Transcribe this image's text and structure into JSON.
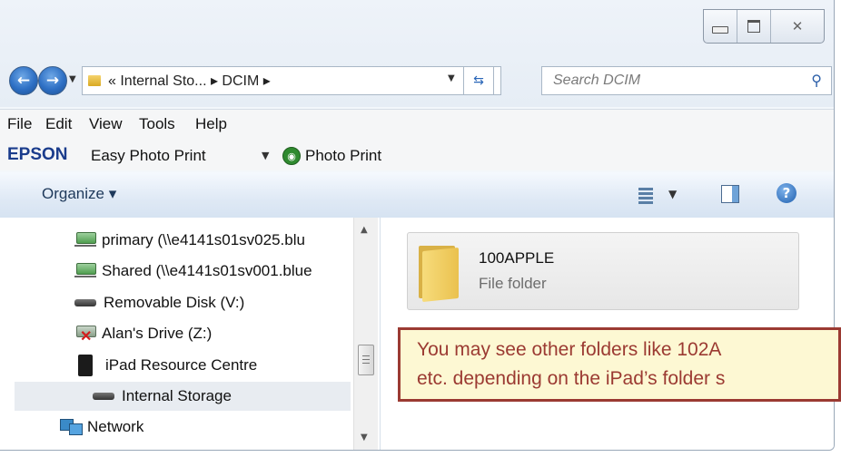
{
  "window": {
    "controls": {
      "minimize": "minimize",
      "maximize": "maximize",
      "close": "close"
    }
  },
  "navigation": {
    "address_path": "« Internal Sto... ▸ DCIM ▸",
    "search_placeholder": "Search DCIM"
  },
  "menu": {
    "items": [
      "File",
      "Edit",
      "View",
      "Tools",
      "Help"
    ]
  },
  "epson_toolbar": {
    "logo": "EPSON",
    "easy_photo_print": "Easy Photo Print",
    "photo_print": "Photo Print"
  },
  "command_bar": {
    "organize": "Organize ▾"
  },
  "nav_tree": {
    "items": [
      {
        "label": "primary (\\\\e4141s01sv025.blu",
        "icon": "network-drive-icon"
      },
      {
        "label": "Shared (\\\\e4141s01sv001.blue",
        "icon": "network-drive-icon"
      },
      {
        "label": "Removable Disk (V:)",
        "icon": "removable-disk-icon"
      },
      {
        "label": "Alan's Drive (Z:)",
        "icon": "disconnected-drive-icon"
      },
      {
        "label": "iPad Resource Centre",
        "icon": "ipad-icon"
      },
      {
        "label": "Internal Storage",
        "icon": "disk-icon",
        "selected": true
      },
      {
        "label": "Network",
        "icon": "network-icon"
      }
    ]
  },
  "content": {
    "folders": [
      {
        "name": "100APPLE",
        "type": "File folder"
      }
    ]
  },
  "callout": {
    "line1": "You may see other folders like 102A",
    "line2": "etc. depending on the iPad’s folder s"
  },
  "colors": {
    "callout_border": "#9b3a32",
    "callout_fill": "#fdf8d3",
    "epson_blue": "#1a3c8c"
  }
}
